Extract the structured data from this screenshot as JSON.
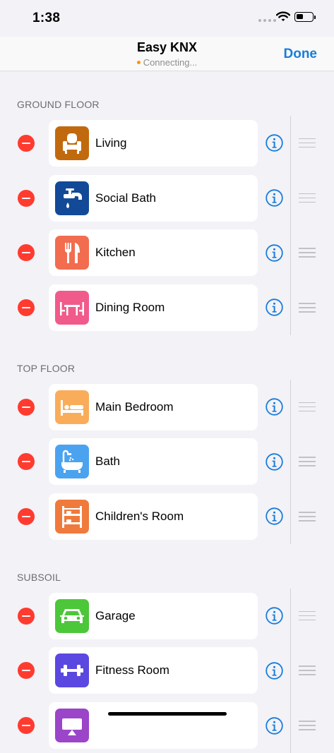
{
  "status_bar": {
    "time": "1:38"
  },
  "nav": {
    "title": "Easy KNX",
    "subtitle": "Connecting...",
    "done_label": "Done",
    "status_color": "#ff9500"
  },
  "colors": {
    "accent": "#1a7cd9",
    "delete": "#ff3b30"
  },
  "sections": [
    {
      "title": "GROUND FLOOR",
      "rooms": [
        {
          "label": "Living",
          "icon": "armchair-icon",
          "color": "#c16a0d"
        },
        {
          "label": "Social Bath",
          "icon": "faucet-icon",
          "color": "#124a97"
        },
        {
          "label": "Kitchen",
          "icon": "fork-knife-icon",
          "color": "#f26c4f"
        },
        {
          "label": "Dining Room",
          "icon": "dining-table-icon",
          "color": "#f05b8b"
        }
      ]
    },
    {
      "title": "TOP FLOOR",
      "rooms": [
        {
          "label": "Main Bedroom",
          "icon": "bed-icon",
          "color": "#f9ad5a"
        },
        {
          "label": "Bath",
          "icon": "bathtub-icon",
          "color": "#4ba3f0"
        },
        {
          "label": "Children's Room",
          "icon": "bunk-bed-icon",
          "color": "#f07a3c"
        }
      ]
    },
    {
      "title": "SUBSOIL",
      "rooms": [
        {
          "label": "Garage",
          "icon": "car-icon",
          "color": "#4cc73a"
        },
        {
          "label": "Fitness Room",
          "icon": "dumbbell-icon",
          "color": "#5b48e0"
        },
        {
          "label": "",
          "icon": "cinema-icon",
          "color": "#9b45c9"
        }
      ]
    }
  ]
}
